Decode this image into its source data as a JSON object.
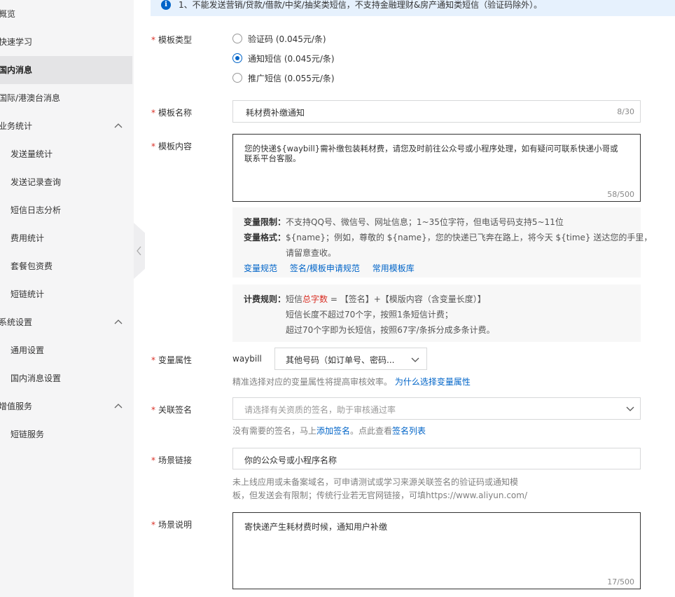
{
  "sidebar": {
    "items": [
      {
        "label": "概览"
      },
      {
        "label": "快速学习"
      },
      {
        "label": "国内消息"
      },
      {
        "label": "国际/港澳台消息"
      },
      {
        "label": "业务统计"
      },
      {
        "label": "发送量统计"
      },
      {
        "label": "发送记录查询"
      },
      {
        "label": "短信日志分析"
      },
      {
        "label": "费用统计"
      },
      {
        "label": "套餐包资费"
      },
      {
        "label": "短链统计"
      },
      {
        "label": "系统设置"
      },
      {
        "label": "通用设置"
      },
      {
        "label": "国内消息设置"
      },
      {
        "label": "增值服务"
      },
      {
        "label": "短链服务"
      }
    ],
    "active": "国内消息"
  },
  "notice": {
    "text": "1、不能发送营销/贷款/借款/中奖/抽奖类短信，不支持金融理财&房产通知类短信（验证码除外）。"
  },
  "form": {
    "required_mark": "*",
    "template_type": {
      "label": "模板类型",
      "options": [
        {
          "label": "验证码 (0.045元/条)",
          "selected": false
        },
        {
          "label": "通知短信 (0.045元/条)",
          "selected": true
        },
        {
          "label": "推广短信 (0.055元/条)",
          "selected": false
        }
      ]
    },
    "template_name": {
      "label": "模板名称",
      "value": "耗材费补缴通知",
      "counter": "8/30"
    },
    "template_content": {
      "label": "模板内容",
      "value_line1": "您的快递${waybill}需补缴包装耗材费，请您及时前往公众号或小程序处理，如有疑问可联系快递小哥或",
      "value_line2": "联系平台客服。",
      "counter": "58/500"
    },
    "rules": {
      "var_limit_label": "变量限制：",
      "var_limit_text": "不支持QQ号、微信号、网址信息；1~35位字符，但电话号码支持5~11位",
      "var_format_label": "变量格式：",
      "var_format_text1": "${name}；例如，尊敬的 ${name}，您的快递已飞奔在路上，将今天 ${time} 送达您的手里，",
      "var_format_text2": "请留意查收。",
      "links": [
        "变量规范",
        "签名/模板申请规范",
        "常用模板库"
      ]
    },
    "billing": {
      "label": "计费规则：",
      "line1_a": "短信",
      "line1_red": "总字数",
      "line1_b": " = 【签名】+【模版内容（含变量长度）】",
      "line2": "短信长度不超过70个字，按照1条短信计费；",
      "line3": "超过70个字即为长短信，按照67字/条拆分成多条计费。"
    },
    "var_attr": {
      "label": "变量属性",
      "var_name": "waybill",
      "select_value": "其他号码（如订单号、密码...",
      "hint": "精准选择对应的变量属性将提高审核效率。",
      "hint_link": "为什么选择变量属性"
    },
    "signature": {
      "label": "关联签名",
      "placeholder": "请选择有关资质的签名，助于审核通过率",
      "hint_a": "没有需要的签名，马上",
      "hint_link1": "添加签名",
      "hint_b": "。点此查看",
      "hint_link2": "签名列表"
    },
    "scene_link": {
      "label": "场景链接",
      "value": "你的公众号或小程序名称",
      "hint1": "未上线应用或未备案域名，可申请测试或学习来源关联签名的验证码或通知模",
      "hint2": "板，但发送会有限制；传统行业若无官网链接，可填https://www.aliyun.com/"
    },
    "scene_desc": {
      "label": "场景说明",
      "value": "寄快递产生耗材费时候，通知用户补缴",
      "counter": "17/500"
    }
  },
  "colors": {
    "primary": "#0064c8",
    "required": "#d93026",
    "sidebar_bg": "#f5f5f6",
    "notice_bg": "#e6f1fd"
  }
}
